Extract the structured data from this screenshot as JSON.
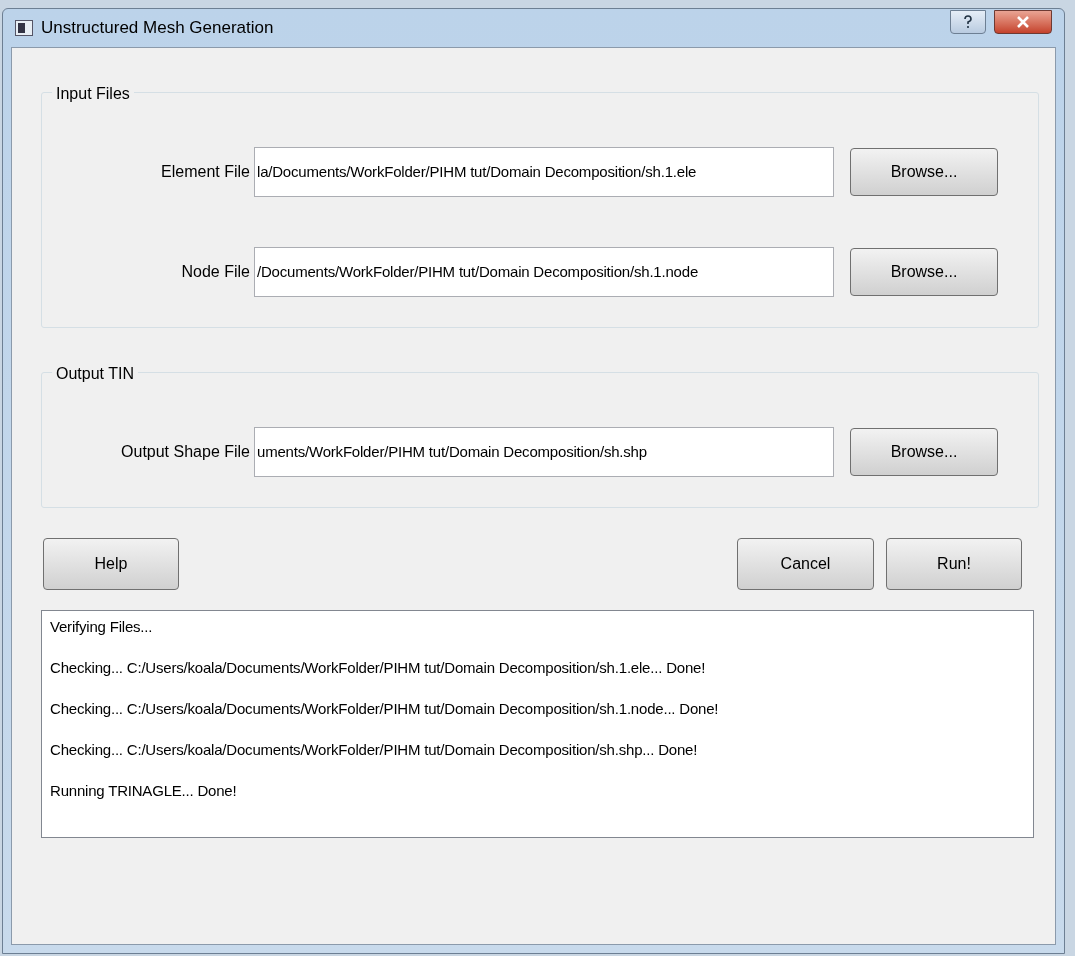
{
  "window": {
    "title": "Unstructured Mesh Generation"
  },
  "groups": [
    {
      "title": "Input Files",
      "rows": [
        {
          "label": "Element File",
          "value": "la/Documents/WorkFolder/PIHM tut/Domain Decomposition/sh.1.ele",
          "button": "Browse..."
        },
        {
          "label": "Node File",
          "value": "/Documents/WorkFolder/PIHM tut/Domain Decomposition/sh.1.node",
          "button": "Browse..."
        }
      ]
    },
    {
      "title": "Output TIN",
      "rows": [
        {
          "label": "Output Shape File",
          "value": "uments/WorkFolder/PIHM tut/Domain Decomposition/sh.shp",
          "button": "Browse..."
        }
      ]
    }
  ],
  "buttons": {
    "help": "Help",
    "cancel": "Cancel",
    "run": "Run!"
  },
  "log": [
    "Verifying Files...",
    "Checking... C:/Users/koala/Documents/WorkFolder/PIHM tut/Domain Decomposition/sh.1.ele... Done!",
    "Checking... C:/Users/koala/Documents/WorkFolder/PIHM tut/Domain Decomposition/sh.1.node... Done!",
    "Checking... C:/Users/koala/Documents/WorkFolder/PIHM tut/Domain Decomposition/sh.shp... Done!",
    "Running TRINAGLE... Done!"
  ]
}
